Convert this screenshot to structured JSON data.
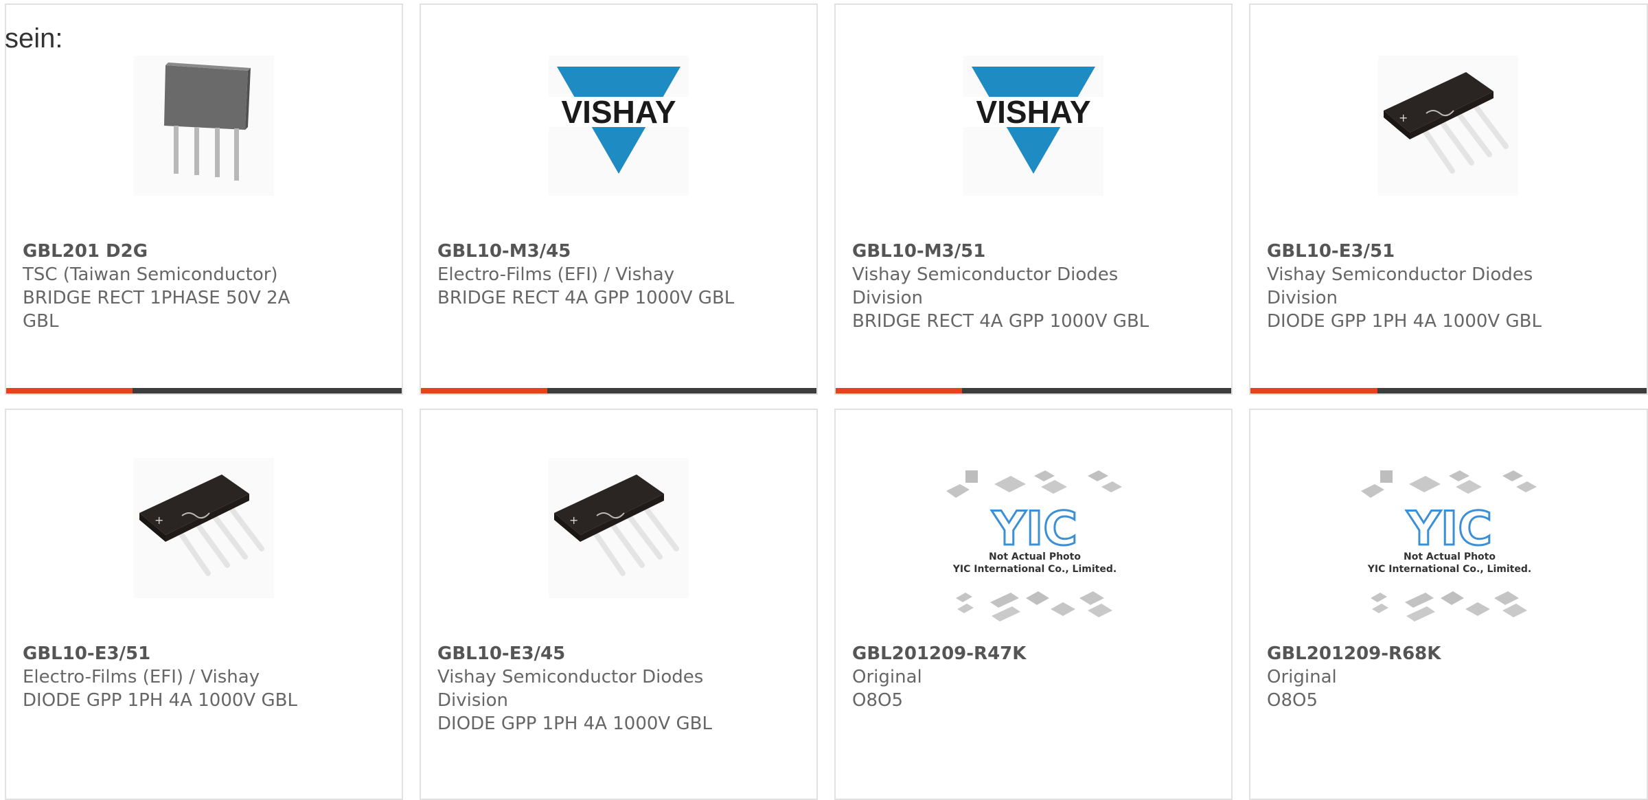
{
  "lead_text": "sein:",
  "colors": {
    "accent": "#e5431c",
    "bar": "#3d3d3d",
    "border": "#e1e1e1",
    "vishay_blue": "#1e8bc3",
    "yic_blue": "#3a8fd6"
  },
  "products": [
    {
      "part_number": "GBL201 D2G",
      "manufacturer": "TSC (Taiwan Semiconductor)",
      "description_lines": [
        "BRIDGE RECT 1PHASE 50V 2A",
        "GBL"
      ],
      "image": "sip4-component-photo"
    },
    {
      "part_number": "GBL10-M3/45",
      "manufacturer": "Electro-Films (EFI) / Vishay",
      "description_lines": [
        "BRIDGE RECT 4A GPP 1000V GBL"
      ],
      "image": "vishay-logo"
    },
    {
      "part_number": "GBL10-M3/51",
      "manufacturer_lines": [
        "Vishay Semiconductor Diodes",
        "Division"
      ],
      "description_lines": [
        "BRIDGE RECT 4A GPP 1000V GBL"
      ],
      "image": "vishay-logo"
    },
    {
      "part_number": "GBL10-E3/51",
      "manufacturer_lines": [
        "Vishay Semiconductor Diodes",
        "Division"
      ],
      "description_lines": [
        "DIODE GPP 1PH 4A 1000V GBL"
      ],
      "image": "gbl-bridge-photo"
    },
    {
      "part_number": "GBL10-E3/51",
      "manufacturer": "Electro-Films (EFI) / Vishay",
      "description_lines": [
        "DIODE GPP 1PH 4A 1000V GBL"
      ],
      "image": "gbl-bridge-photo"
    },
    {
      "part_number": "GBL10-E3/45",
      "manufacturer_lines": [
        "Vishay Semiconductor Diodes",
        "Division"
      ],
      "description_lines": [
        "DIODE GPP 1PH 4A 1000V GBL"
      ],
      "image": "gbl-bridge-photo"
    },
    {
      "part_number": "GBL201209-R47K",
      "manufacturer": "Original",
      "description_lines": [
        "O8O5"
      ],
      "image": "yic-placeholder"
    },
    {
      "part_number": "GBL201209-R68K",
      "manufacturer": "Original",
      "description_lines": [
        "O8O5"
      ],
      "image": "yic-placeholder"
    }
  ],
  "logos": {
    "vishay": "VISHAY",
    "yic_caption_1": "Not Actual Photo",
    "yic_caption_2": "YIC International Co., Limited."
  }
}
